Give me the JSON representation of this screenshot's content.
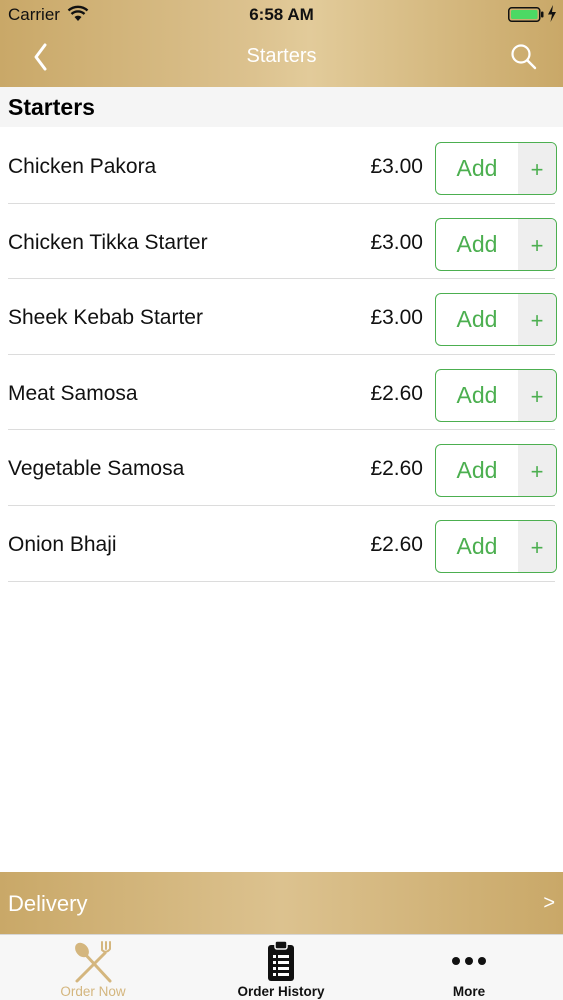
{
  "status_bar": {
    "carrier": "Carrier",
    "time": "6:58 AM"
  },
  "nav": {
    "title": "Starters",
    "back_icon": "chevron-left-icon",
    "search_icon": "search-icon"
  },
  "section": {
    "title": "Starters"
  },
  "menu_items": [
    {
      "name": "Chicken Pakora",
      "price": "£3.00",
      "add_label": "Add",
      "plus_label": "+"
    },
    {
      "name": "Chicken Tikka Starter",
      "price": "£3.00",
      "add_label": "Add",
      "plus_label": "+"
    },
    {
      "name": "Sheek Kebab Starter",
      "price": "£3.00",
      "add_label": "Add",
      "plus_label": "+"
    },
    {
      "name": "Meat Samosa",
      "price": "£2.60",
      "add_label": "Add",
      "plus_label": "+"
    },
    {
      "name": "Vegetable Samosa",
      "price": "£2.60",
      "add_label": "Add",
      "plus_label": "+"
    },
    {
      "name": "Onion Bhaji",
      "price": "£2.60",
      "add_label": "Add",
      "plus_label": "+"
    }
  ],
  "delivery": {
    "label": "Delivery",
    "chevron": ">"
  },
  "tabs": [
    {
      "label": "Order Now",
      "icon": "fork-knife-icon",
      "active": true
    },
    {
      "label": "Order History",
      "icon": "clipboard-list-icon",
      "active": false
    },
    {
      "label": "More",
      "icon": "more-dots-icon",
      "active": false
    }
  ],
  "colors": {
    "brand_gold": "#d4b67e",
    "add_green": "#4caf50"
  }
}
